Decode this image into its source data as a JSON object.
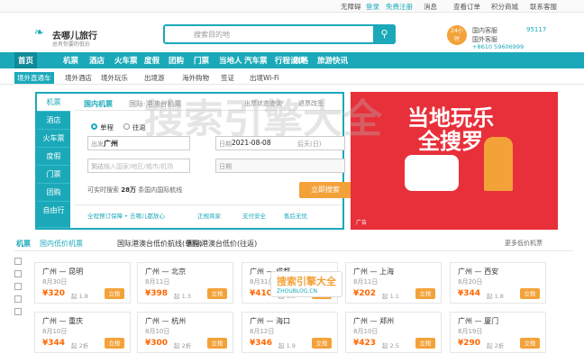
{
  "top_links": {
    "no_barrier": "无障碍",
    "login": "登录",
    "register": "免费注册",
    "messages": "消息",
    "orders": "查看订单",
    "points": "积分商城",
    "contact": "联系客服"
  },
  "logo": {
    "name": "去哪儿旅行",
    "slogan": "总有你要的低价"
  },
  "search": {
    "placeholder": "搜索目的地"
  },
  "customer_service": {
    "clock_top": "24小",
    "clock_bottom": "时",
    "domestic": "国内客服",
    "domestic_number": "95117",
    "overseas": "国外客服",
    "overseas_number": "+8610 59606999"
  },
  "nav": [
    "首页",
    "机票",
    "酒店",
    "火车票",
    "度假",
    "团购",
    "门票",
    "当地人",
    "汽车票",
    "行程设计",
    "攻略",
    "旅游快讯"
  ],
  "subnav": {
    "tag": "境外直通车",
    "items": [
      "境外酒店",
      "境外玩乐",
      "出境游",
      "海外购物",
      "签证",
      "出境Wi-Fi"
    ]
  },
  "panel": {
    "side_tabs": [
      "机票",
      "酒店",
      "火车票",
      "度假",
      "门票",
      "团购",
      "自由行"
    ],
    "tabs": [
      "国内机票",
      "国际·港澳台机票"
    ],
    "links": [
      "出票状态查询",
      "退票改签"
    ],
    "trip_types": [
      "单程",
      "往返"
    ],
    "from_label": "出发",
    "from_value": "广州",
    "date_label": "日期",
    "date_value": "2021-08-08",
    "date_day": "后天(日)",
    "to_label": "到达",
    "to_placeholder": "输入国家/地区/城市/机场",
    "date2_label": "日期",
    "search_btn": "立即搜索",
    "stats_prefix": "可实时搜索",
    "stats_number": "28万",
    "stats_suffix": "条国内国际航线",
    "guarantees": [
      "全程预订保障 • 去哪儿都放心",
      "正规商家",
      "支付安全",
      "售后无忧"
    ]
  },
  "banner": {
    "line1": "当地玩乐",
    "line2": "全搜罗",
    "ad": "广告"
  },
  "deals": {
    "section": "机票",
    "tabs": [
      "国内低价机票",
      "国际港澳台低价航线(单程)",
      "国际港澳台低价(往返)"
    ],
    "more": "更多低价机票",
    "buy": "立抢",
    "items": [
      {
        "route": "广州 — 昆明",
        "date": "8月30日",
        "price": "¥320",
        "discount": "起 1.8"
      },
      {
        "route": "广州 — 北京",
        "date": "8月11日",
        "price": "¥398",
        "discount": "起 1.3"
      },
      {
        "route": "广州 — 成都",
        "date": "8月31日",
        "price": "¥410",
        "discount": "起 1.8"
      },
      {
        "route": "广州 — 上海",
        "date": "8月11日",
        "price": "¥202",
        "discount": "起 1.1"
      },
      {
        "route": "广州 — 西安",
        "date": "8月20日",
        "price": "¥344",
        "discount": "起 1.8"
      },
      {
        "route": "广州 — 重庆",
        "date": "8月10日",
        "price": "¥344",
        "discount": "起 2折"
      },
      {
        "route": "广州 — 杭州",
        "date": "8月10日",
        "price": "¥300",
        "discount": "起 2折"
      },
      {
        "route": "广州 — 海口",
        "date": "8月12日",
        "price": "¥346",
        "discount": "起 1.9"
      },
      {
        "route": "广州 — 郑州",
        "date": "8月10日",
        "price": "¥423",
        "discount": "起 2.5"
      },
      {
        "route": "广州 — 厦门",
        "date": "8月19日",
        "price": "¥290",
        "discount": "起 2折"
      }
    ]
  },
  "watermark": {
    "text": "搜索引擎大全",
    "site": "ZHOUBLOG.CN"
  }
}
